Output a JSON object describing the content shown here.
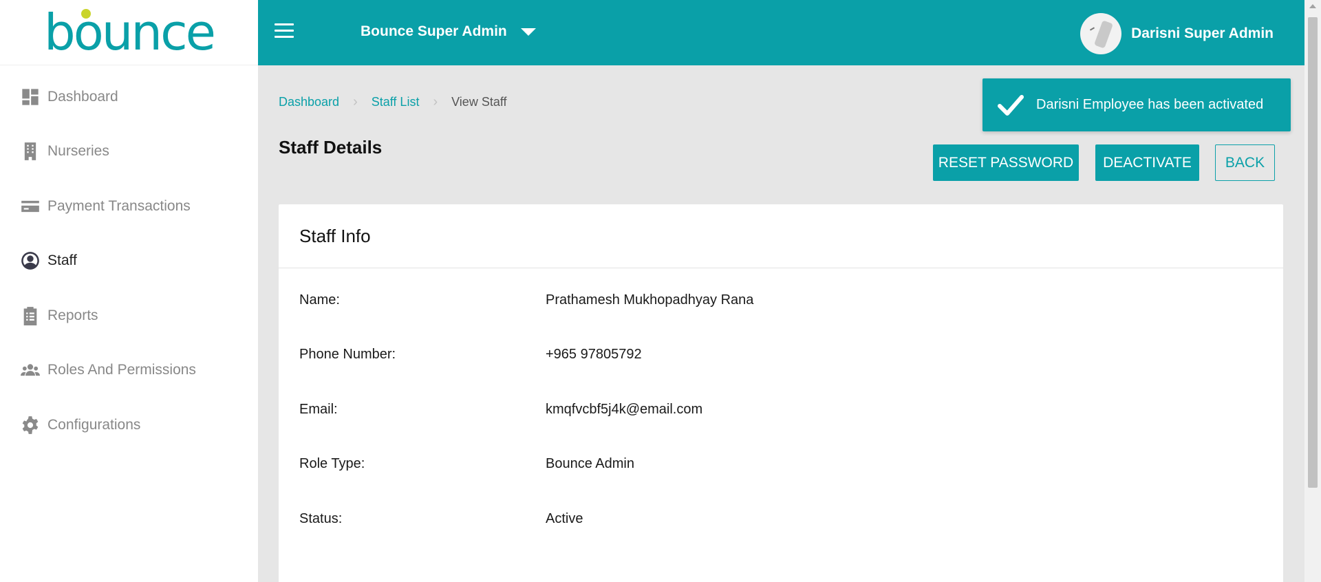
{
  "brand": {
    "logo_text": "bounce",
    "accent": "#0aa0a8",
    "logo_dot": "#c9d42b"
  },
  "sidebar": {
    "items": [
      {
        "label": "Dashboard",
        "icon": "dashboard-icon"
      },
      {
        "label": "Nurseries",
        "icon": "building-icon"
      },
      {
        "label": "Payment Transactions",
        "icon": "credit-card-icon"
      },
      {
        "label": "Staff",
        "icon": "user-circle-icon",
        "active": true
      },
      {
        "label": "Reports",
        "icon": "clipboard-icon"
      },
      {
        "label": "Roles And Permissions",
        "icon": "users-group-icon"
      },
      {
        "label": "Configurations",
        "icon": "gear-icon"
      }
    ]
  },
  "header": {
    "org_name": "Bounce Super Admin",
    "user_name": "Darisni Super Admin"
  },
  "breadcrumb": [
    "Dashboard",
    "Staff List",
    "View Staff"
  ],
  "page": {
    "title": "Staff Details"
  },
  "actions": {
    "reset": "RESET PASSWORD",
    "deactivate": "DEACTIVATE",
    "back": "BACK"
  },
  "toast": {
    "message": "Darisni Employee has been activated"
  },
  "card": {
    "title": "Staff Info",
    "fields": [
      {
        "label": "Name:",
        "value": "Prathamesh Mukhopadhyay Rana"
      },
      {
        "label": "Phone Number:",
        "value": "+965 97805792"
      },
      {
        "label": "Email:",
        "value": "kmqfvcbf5j4k@email.com"
      },
      {
        "label": "Role Type:",
        "value": "Bounce Admin"
      },
      {
        "label": "Status:",
        "value": "Active"
      }
    ]
  }
}
